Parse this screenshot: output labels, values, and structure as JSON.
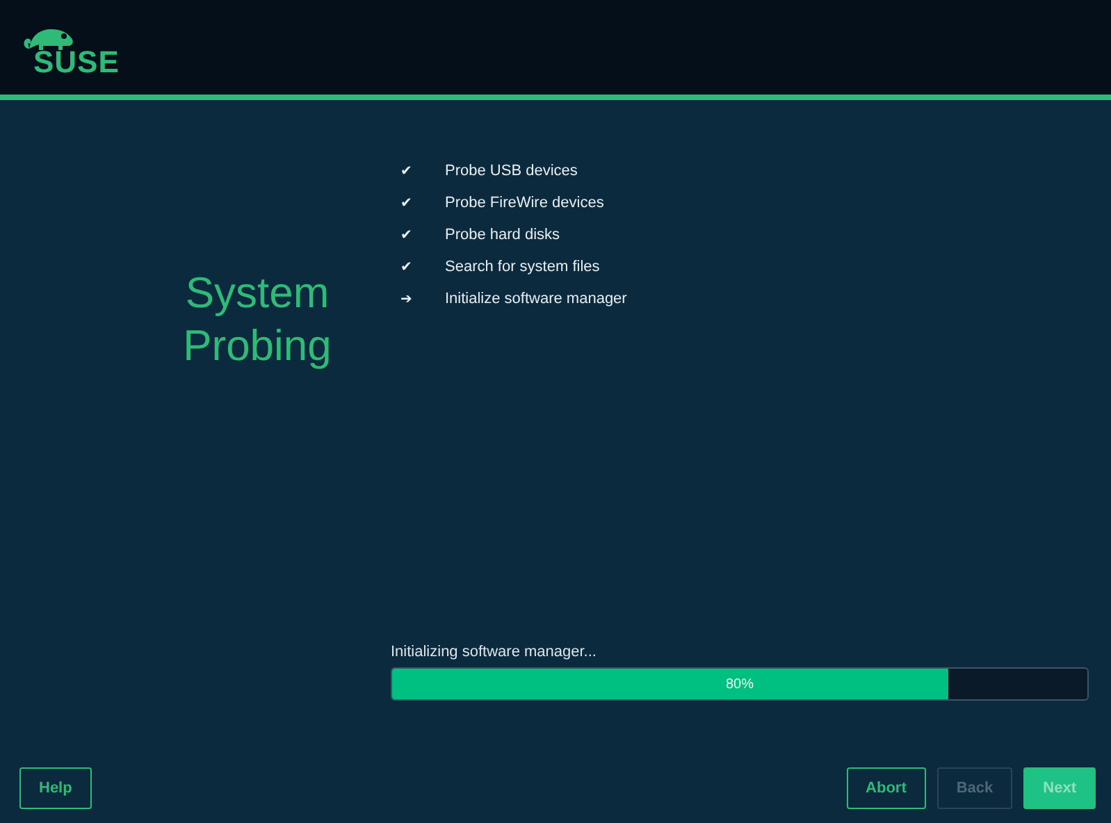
{
  "header": {
    "logo_text": "SUSE"
  },
  "title": "System Probing",
  "steps": [
    {
      "mark": "✔",
      "label": "Probe USB devices"
    },
    {
      "mark": "✔",
      "label": "Probe FireWire devices"
    },
    {
      "mark": "✔",
      "label": "Probe hard disks"
    },
    {
      "mark": "✔",
      "label": "Search for system files"
    },
    {
      "mark": "➔",
      "label": "Initialize software manager"
    }
  ],
  "progress": {
    "label": "Initializing software manager...",
    "level": 0.8,
    "reading": "80%"
  },
  "buttons": [
    {
      "label": "Help",
      "kind": "outline",
      "disabled": false
    },
    {
      "label": "Abort",
      "kind": "outline",
      "disabled": false
    },
    {
      "label": "Back",
      "kind": "outline",
      "disabled": true
    },
    {
      "label": "Next",
      "kind": "primary",
      "disabled": true
    }
  ]
}
